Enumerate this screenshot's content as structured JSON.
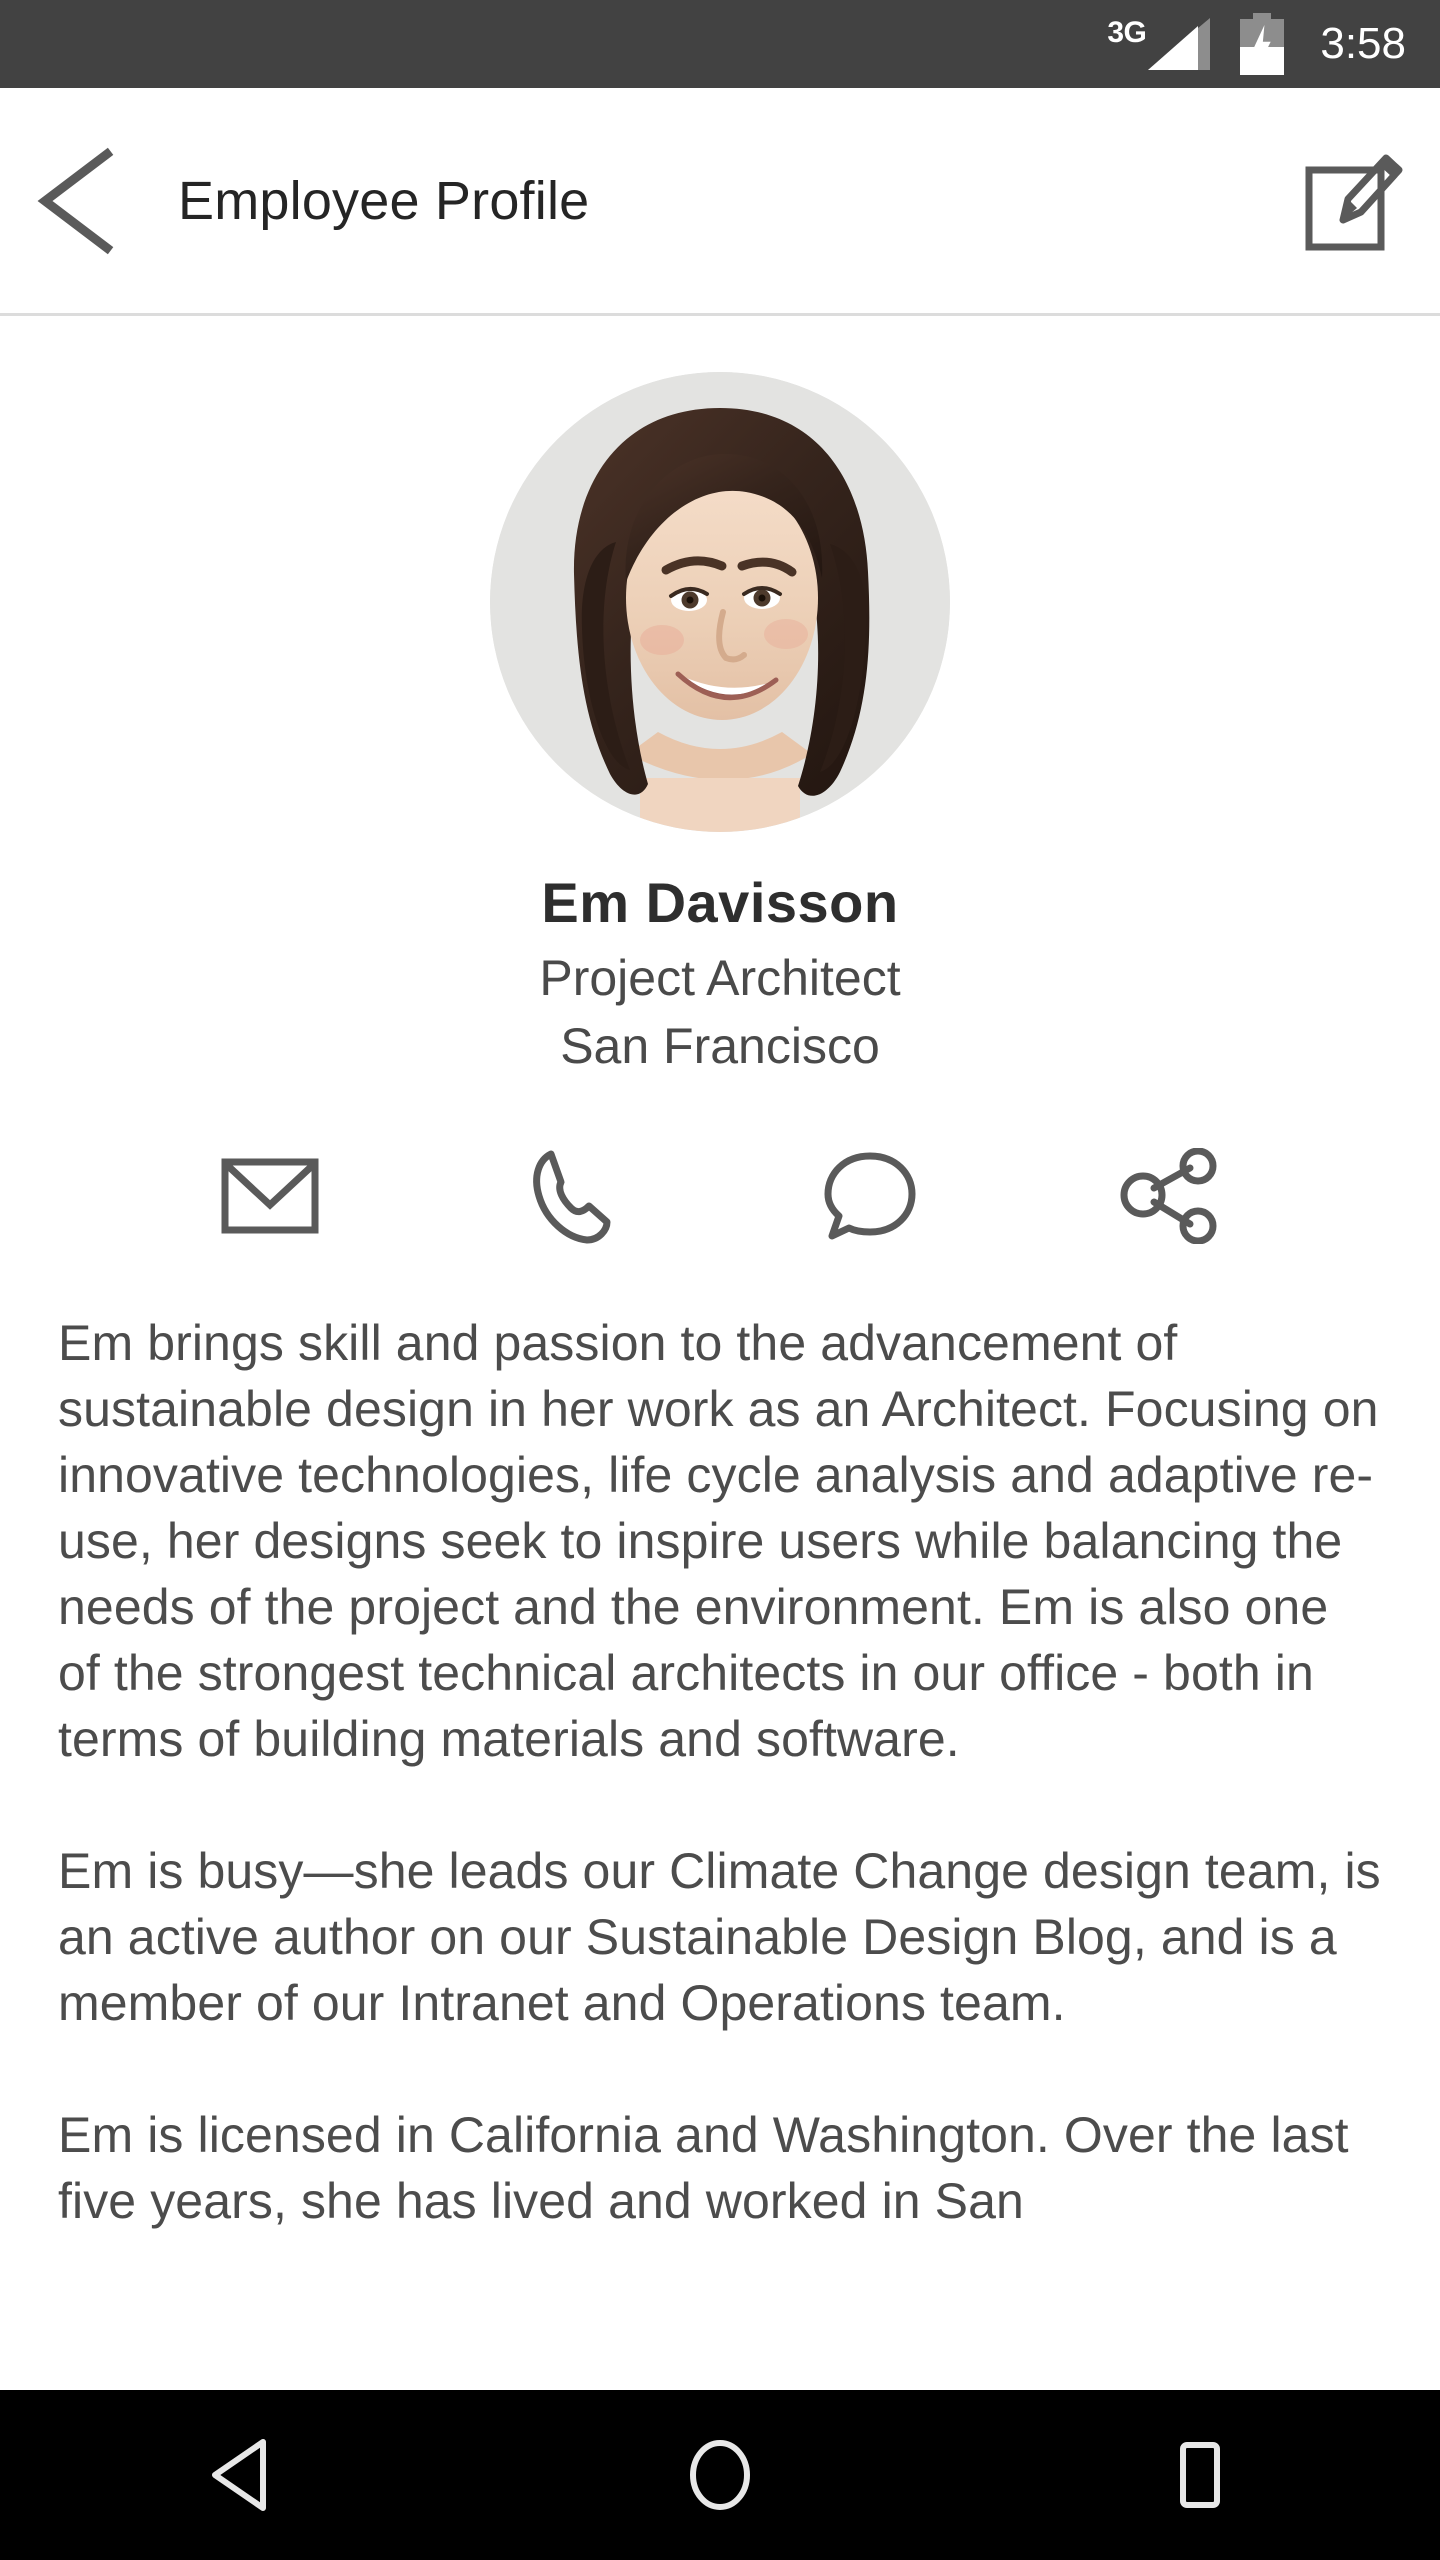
{
  "status_bar": {
    "network_label": "3G",
    "time": "3:58",
    "icons": [
      "signal-icon",
      "battery-charging-icon"
    ],
    "background_color": "#424242",
    "foreground_color": "#ffffff"
  },
  "app_bar": {
    "back_label": "back-icon",
    "title": "Employee Profile",
    "edit_label": "edit-icon"
  },
  "profile": {
    "avatar_alt": "avatar-photo",
    "name": "Em Davisson",
    "role": "Project Architect",
    "location": "San Francisco"
  },
  "actions": [
    {
      "name": "email",
      "icon": "envelope-icon"
    },
    {
      "name": "phone",
      "icon": "phone-icon"
    },
    {
      "name": "message",
      "icon": "chat-bubble-icon"
    },
    {
      "name": "share",
      "icon": "share-icon"
    }
  ],
  "bio": {
    "paragraph_1": "Em brings skill and passion to the advancement of sustainable design in her work as an Architect. Focusing on innovative technologies, life cycle analysis and adaptive re-use, her designs seek to inspire users while balancing the needs of the project and the environment. Em is also one of the strongest technical architects in our office - both in terms of building materials and software.",
    "paragraph_2": "Em is busy—she leads our Climate Change design team, is an active author on our Sustainable Design Blog, and is a member of our Intranet and Operations team.",
    "paragraph_3": "Em is licensed in California and Washington. Over the last five years, she has lived and worked in San"
  },
  "nav_bar": {
    "back": "nav-back-icon",
    "home": "nav-home-icon",
    "recents": "nav-recents-icon",
    "background_color": "#000000"
  },
  "colors": {
    "status_bar": "#424242",
    "app_bar_text": "#252525",
    "body_text": "#4c4c4c",
    "icon_stroke": "#5a5a5a",
    "divider": "#dcdcdc",
    "nav_bar": "#000000"
  }
}
